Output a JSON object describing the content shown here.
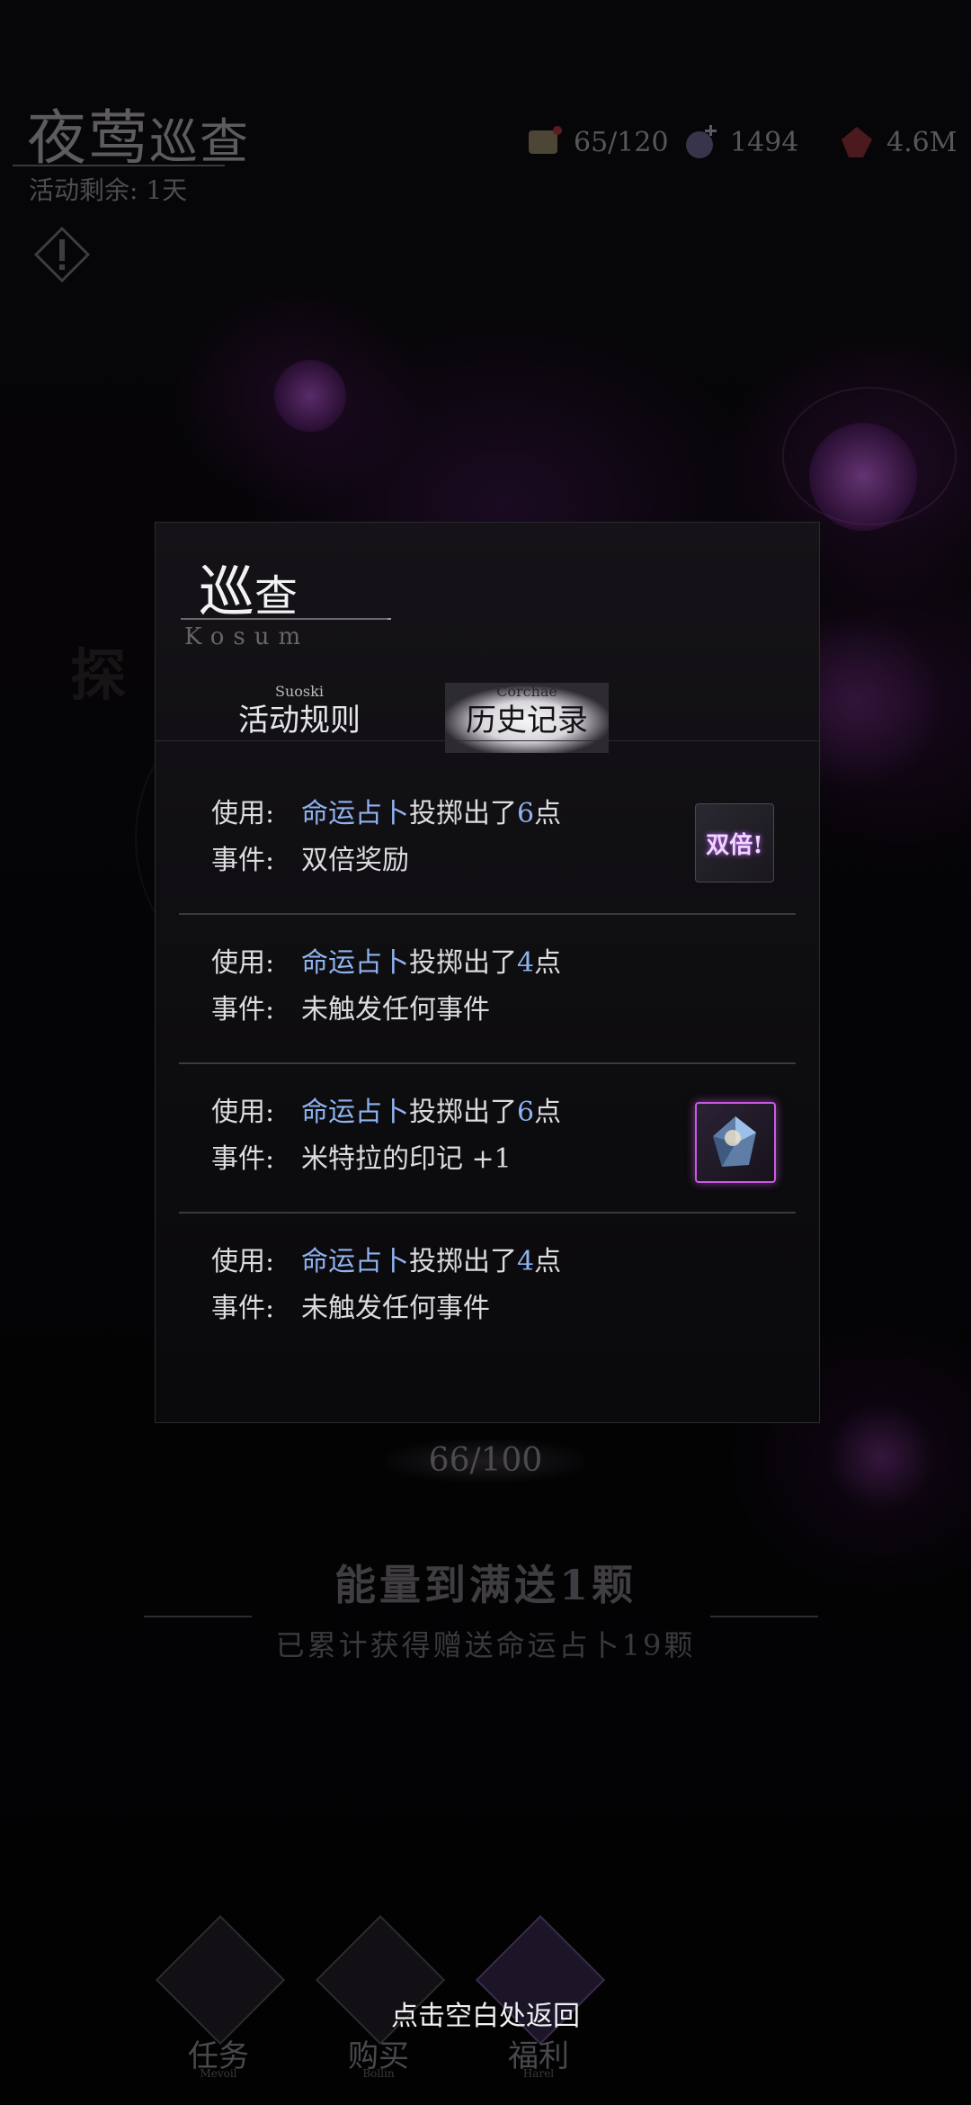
{
  "header": {
    "title_big": "夜莺",
    "title_small": "巡查",
    "remaining": "活动剩余: 1天"
  },
  "resources": [
    {
      "icon": "stamina-scroll-icon",
      "value": "65/120"
    },
    {
      "icon": "crystal-plus-icon",
      "value": "1494"
    },
    {
      "icon": "red-gem-icon",
      "value": "4.6M"
    }
  ],
  "background_text": "探",
  "dialog": {
    "title_big": "巡",
    "title_small": "查",
    "subtitle": "Kosum",
    "tabs": [
      {
        "en": "Suoski",
        "zh": "活动规则",
        "active": false
      },
      {
        "en": "Corchae",
        "zh": "历史记录",
        "active": true
      }
    ],
    "use_label": "使用:",
    "event_label": "事件:",
    "records": [
      {
        "item": "命运占卜",
        "roll_text": "投掷出了",
        "roll": "6",
        "unit": "点",
        "event": "双倍奖励",
        "reward": "双倍!"
      },
      {
        "item": "命运占卜",
        "roll_text": "投掷出了",
        "roll": "4",
        "unit": "点",
        "event": "未触发任何事件",
        "reward": ""
      },
      {
        "item": "命运占卜",
        "roll_text": "投掷出了",
        "roll": "6",
        "unit": "点",
        "event": "米特拉的印记 +1",
        "reward": "mark-card-icon"
      },
      {
        "item": "命运占卜",
        "roll_text": "投掷出了",
        "roll": "4",
        "unit": "点",
        "event": "未触发任何事件",
        "reward": ""
      }
    ]
  },
  "energy": {
    "progress": "66/100",
    "full_gift": "能量到满送1颗",
    "total_gifted": "已累计获得赠送命运占卜19颗"
  },
  "nav": [
    {
      "label": "任务",
      "en": "Mevoil"
    },
    {
      "label": "购买",
      "en": "Bollin"
    },
    {
      "label": "福利",
      "en": "Harel"
    }
  ],
  "back_hint": "点击空白处返回",
  "colors": {
    "highlight_blue": "#8fb2f0",
    "accent_purple": "#c85ce0"
  }
}
